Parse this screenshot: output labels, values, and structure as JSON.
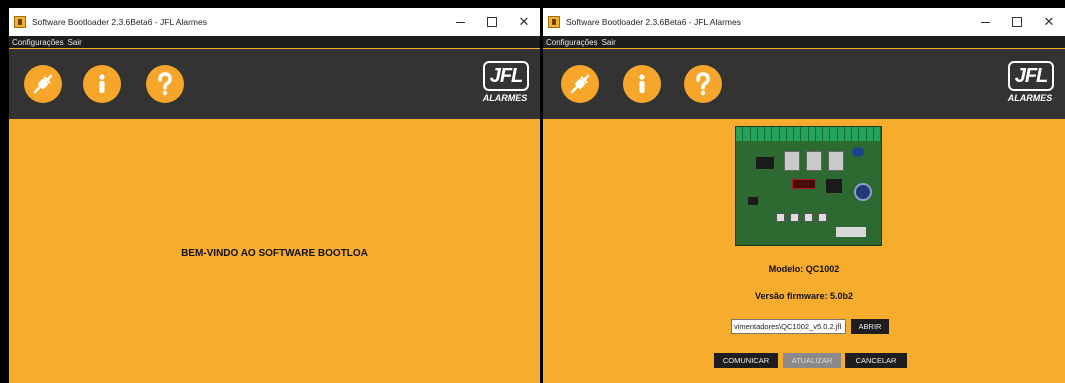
{
  "windows": [
    {
      "title": "Software Bootloader 2.3.6Beta6 - JFL Alarmes",
      "menu": [
        "Configurações",
        "Sair"
      ],
      "controls": {
        "minimize": "—",
        "maximize": "☐",
        "close": "✕"
      },
      "toolbar": [
        "plug-icon",
        "info-icon",
        "help-icon"
      ],
      "logo": {
        "main": "JFL",
        "sub": "ALARMES"
      },
      "welcome_text": "BEM-VINDO AO SOFTWARE BOOTLOA"
    },
    {
      "title": "Software Bootloader 2.3.6Beta6 - JFL Alarmes",
      "menu": [
        "Configurações",
        "Sair"
      ],
      "controls": {
        "minimize": "—",
        "maximize": "☐",
        "close": "✕"
      },
      "toolbar": [
        "plug-icon",
        "info-icon",
        "help-icon"
      ],
      "logo": {
        "main": "JFL",
        "sub": "ALARMES"
      },
      "model_text": "Modelo: QC1002",
      "firmware_text": "Versão firmware: 5.0b2",
      "file_path": "vimentadores\\QC1002_v5.0.2.jfl",
      "open_label": "ABRIR",
      "buttons": {
        "communicate": "COMUNICAR",
        "update": "ATUALIZAR",
        "cancel": "CANCELAR"
      }
    }
  ],
  "colors": {
    "background": "#f8ac2d",
    "toolbar": "#333333",
    "menubar": "#1e1e1e",
    "accent": "#f6a62b"
  }
}
